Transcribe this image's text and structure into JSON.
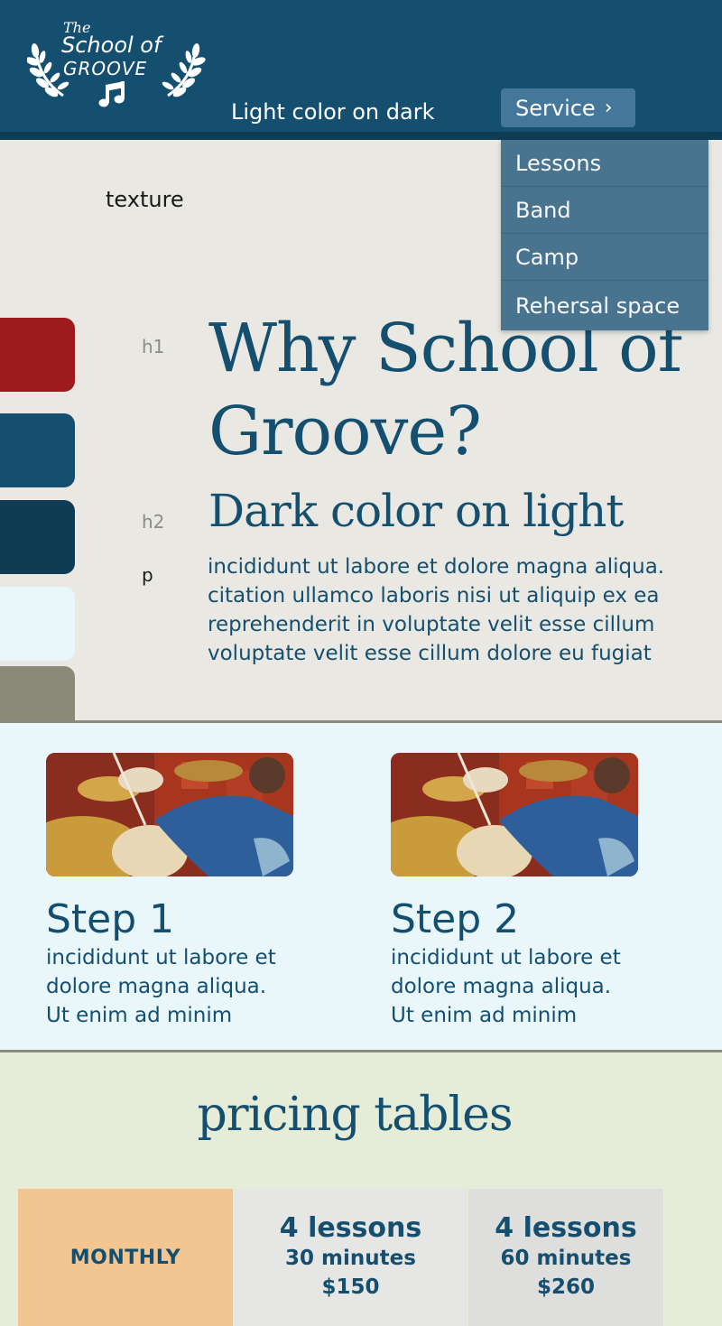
{
  "header": {
    "logo": {
      "the": "The",
      "school_of": "School of",
      "groove": "GROOVE"
    },
    "caption": "Light color on dark",
    "service_button": {
      "label": "Service",
      "chevron": "›"
    }
  },
  "dropdown": {
    "items": [
      "Lessons",
      "Band",
      "Camp",
      "Rehersal space"
    ]
  },
  "style_guide": {
    "texture_label": "texture",
    "swatches": [
      "#9e1b1d",
      "#154f70",
      "#0f3b55",
      "#e9f6fa",
      "#8b8a79"
    ],
    "tags": {
      "h1": "h1",
      "h2": "h2",
      "p": "p"
    },
    "h1_line1": "Why School of",
    "h1_line2": "Groove?",
    "h2": "Dark color on light",
    "paragraph_lines": [
      "incididunt ut labore et dolore magna aliqua.",
      "citation ullamco laboris nisi ut aliquip ex ea",
      "reprehenderit in voluptate velit esse cillum",
      "voluptate velit esse cillum dolore eu fugiat"
    ]
  },
  "steps": [
    {
      "title": "Step 1",
      "lines": [
        "incididunt ut labore et",
        "dolore magna aliqua.",
        "Ut enim ad minim"
      ]
    },
    {
      "title": "Step 2",
      "lines": [
        "incididunt ut labore et",
        "dolore magna aliqua.",
        "Ut enim ad minim"
      ]
    }
  ],
  "pricing": {
    "title": "pricing tables",
    "columns": [
      {
        "label": "MONTHLY",
        "color": "#f3c591"
      },
      {
        "title": "4 lessons",
        "duration": "30 minutes",
        "price": "$150",
        "color": "#e6e6e4"
      },
      {
        "title": "4 lessons",
        "duration": "60 minutes",
        "price": "$260",
        "color": "#dededc"
      }
    ]
  },
  "colors": {
    "primary": "#154f70",
    "dark": "#0f3b55",
    "light": "#e9f6fa",
    "accent_red": "#9e1b1d",
    "neutral": "#8b8a79"
  }
}
